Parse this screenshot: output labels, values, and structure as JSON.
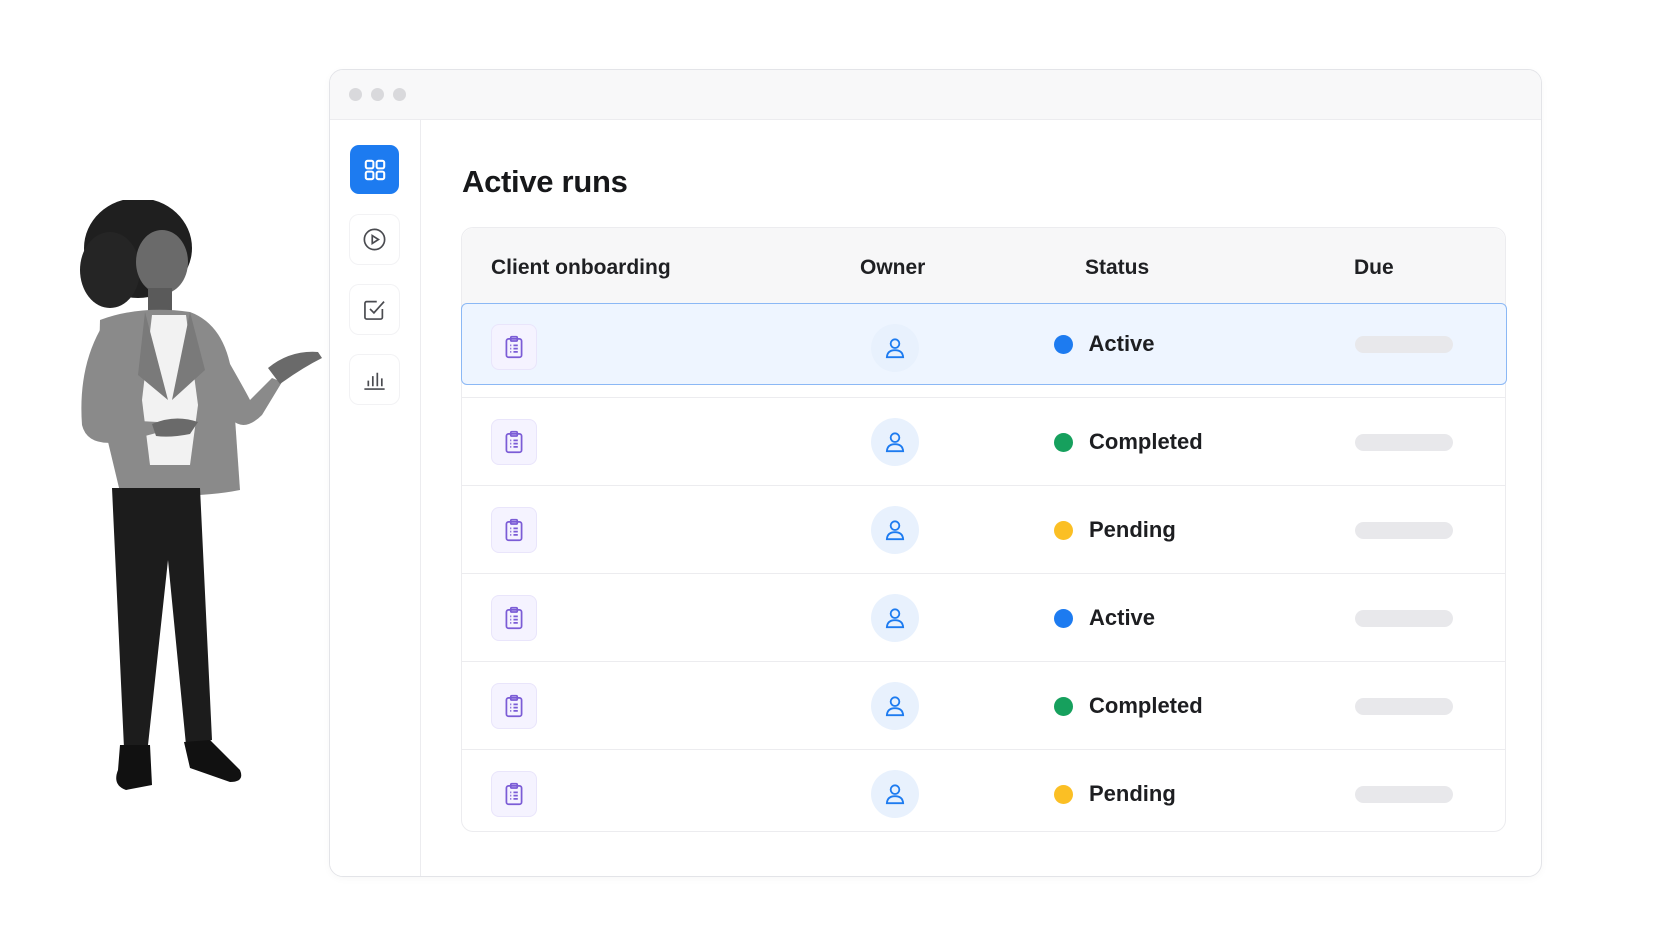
{
  "page": {
    "title": "Active runs"
  },
  "sidebar": {
    "items": [
      {
        "name": "dashboard",
        "icon": "grid-icon",
        "active": true
      },
      {
        "name": "runs",
        "icon": "play-circle-icon",
        "active": false
      },
      {
        "name": "tasks",
        "icon": "checkbox-icon",
        "active": false
      },
      {
        "name": "reports",
        "icon": "bar-chart-icon",
        "active": false
      }
    ]
  },
  "table": {
    "columns": [
      "Client onboarding",
      "Owner",
      "Status",
      "Due"
    ],
    "rows": [
      {
        "status": "Active",
        "status_color": "#1d7bf0",
        "selected": true
      },
      {
        "status": "Completed",
        "status_color": "#16a05d",
        "selected": false
      },
      {
        "status": "Pending",
        "status_color": "#fbbf24",
        "selected": false
      },
      {
        "status": "Active",
        "status_color": "#1d7bf0",
        "selected": false
      },
      {
        "status": "Completed",
        "status_color": "#16a05d",
        "selected": false
      },
      {
        "status": "Pending",
        "status_color": "#fbbf24",
        "selected": false
      }
    ]
  },
  "colors": {
    "accent": "#1d7bf0",
    "clipboard": "#7b5cd6",
    "owner": "#1d7bf0"
  }
}
